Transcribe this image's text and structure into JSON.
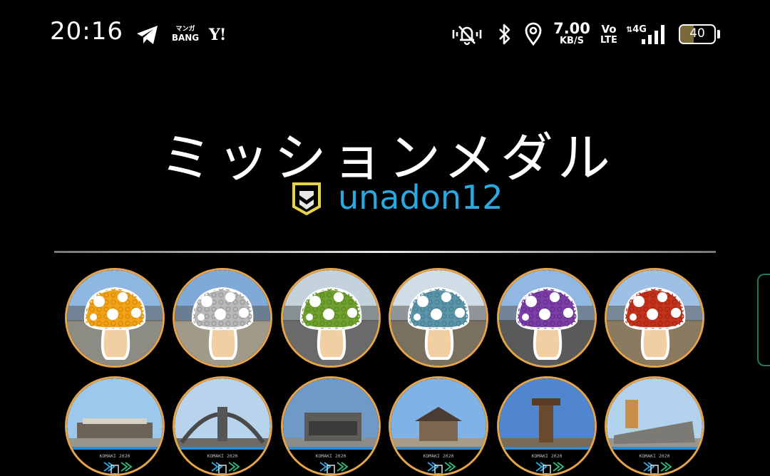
{
  "status_bar": {
    "time": "20:16",
    "manga_l1": "マンガ",
    "manga_l2": "BANG",
    "yahoo": "Y!",
    "speed_value": "7.00",
    "speed_unit": "KB/S",
    "volte_l1": "Vo",
    "volte_l2": "LTE",
    "network": "4G",
    "battery_level": "40",
    "icons": [
      "telegram-icon",
      "manga-bang-icon",
      "yahoo-icon",
      "mute-vibrate-icon",
      "bluetooth-icon",
      "location-icon",
      "data-speed",
      "volte-icon",
      "signal-icon",
      "battery-icon"
    ]
  },
  "header": {
    "title": "ミッションメダル",
    "username": "unadon12",
    "faction_colors": {
      "yellow": "#e6d34a",
      "white": "#e6e6e6"
    },
    "username_color": "#29a9df"
  },
  "medals_row1": [
    {
      "name": "orange-mushroom",
      "cap": "#f2a216",
      "pattern": "#d98a0a",
      "sky": "#8fb8e0",
      "ground": "#8c8c84"
    },
    {
      "name": "gray-mushroom",
      "cap": "#b9b9b9",
      "pattern": "#9a9a9a",
      "sky": "#7fa9d8",
      "ground": "#a09a8a"
    },
    {
      "name": "green-mushroom",
      "cap": "#6fa02e",
      "pattern": "#5a8a22",
      "sky": "#c4d2de",
      "ground": "#6a6a6a"
    },
    {
      "name": "teal-mushroom",
      "cap": "#5a94a8",
      "pattern": "#4a8094",
      "sky": "#d0dde6",
      "ground": "#7a7060"
    },
    {
      "name": "purple-mushroom",
      "cap": "#7a3ea6",
      "pattern": "#652f8e",
      "sky": "#90b8e2",
      "ground": "#5a5a5a"
    },
    {
      "name": "red-mushroom",
      "cap": "#c2321c",
      "pattern": "#a82610",
      "sky": "#9ec0e4",
      "ground": "#8a7a60"
    }
  ],
  "medals_row2": [
    {
      "name": "komaki-2020-museum",
      "label": "KOMAKI 2020",
      "sky": "#9cc8ee",
      "scene": "#9a958a"
    },
    {
      "name": "komaki-2020-gate",
      "label": "KOMAKI 2020",
      "sky": "#b8d4ec",
      "scene": "#6d6a64"
    },
    {
      "name": "komaki-2020-building",
      "label": "KOMAKI 2020",
      "sky": "#6f9ac8",
      "scene": "#8d8b88"
    },
    {
      "name": "komaki-2020-temple",
      "label": "KOMAKI 2020",
      "sky": "#7fb2e6",
      "scene": "#a89c86"
    },
    {
      "name": "komaki-2020-totem",
      "label": "KOMAKI 2020",
      "sky": "#4f86cf",
      "scene": "#7b6a56"
    },
    {
      "name": "komaki-2020-stone",
      "label": "KOMAKI 2020",
      "sky": "#b2d2ee",
      "scene": "#9a968e"
    }
  ],
  "accent": "#e3a44c"
}
